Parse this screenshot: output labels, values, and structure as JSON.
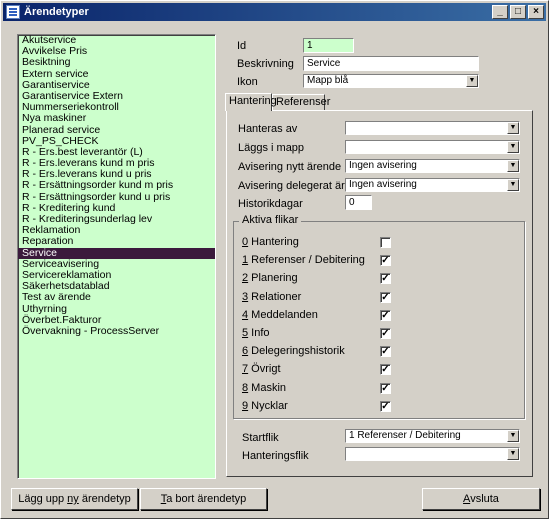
{
  "window": {
    "title": "Ärendetyper"
  },
  "list": {
    "items": [
      "Akutservice",
      "Avvikelse Pris",
      "Besiktning",
      "Extern service",
      "Garantiservice",
      "Garantiservice Extern",
      "Nummerseriekontroll",
      "Nya maskiner",
      "Planerad service",
      "PV_PS_CHECK",
      "R - Ers.best leverantör (L)",
      "R - Ers.leverans kund m pris",
      "R - Ers.leverans kund u pris",
      "R - Ersättningsorder kund m pris",
      "R - Ersättningsorder kund u pris",
      "R - Kreditering kund",
      "R - Krediteringsunderlag lev",
      "Reklamation",
      "Reparation",
      "Service",
      "Serviceavisering",
      "Servicereklamation",
      "Säkerhetsdatablad",
      "Test av ärende",
      "Uthyrning",
      "Överbet.Fakturor",
      "Övervakning - ProcessServer"
    ],
    "selected": "Service"
  },
  "form": {
    "id_label": "Id",
    "id_value": "1",
    "beskrivning_label": "Beskrivning",
    "beskrivning_value": "Service",
    "ikon_label": "Ikon",
    "ikon_value": "Mapp blå"
  },
  "tabs": [
    "Hantering",
    "Referenser"
  ],
  "hantering": {
    "hanteras_av_label": "Hanteras av",
    "hanteras_av_value": "",
    "laggs_i_mapp_label": "Läggs i mapp",
    "laggs_i_mapp_value": "",
    "avisering_nytt_label": "Avisering nytt ärende",
    "avisering_nytt_value": "Ingen avisering",
    "avisering_deleg_label": "Avisering delegerat ärende",
    "avisering_deleg_value": "Ingen avisering",
    "historikdagar_label": "Historikdagar",
    "historikdagar_value": "0"
  },
  "aktiva_flikar": {
    "title": "Aktiva flikar",
    "items": [
      {
        "key": "0",
        "rest": " Hantering",
        "checked": false
      },
      {
        "key": "1",
        "rest": " Referenser / Debitering",
        "checked": true
      },
      {
        "key": "2",
        "rest": " Planering",
        "checked": true
      },
      {
        "key": "3",
        "rest": " Relationer",
        "checked": true
      },
      {
        "key": "4",
        "rest": " Meddelanden",
        "checked": true
      },
      {
        "key": "5",
        "rest": " Info",
        "checked": true
      },
      {
        "key": "6",
        "rest": " Delegeringshistorik",
        "checked": true
      },
      {
        "key": "7",
        "rest": " Övrigt",
        "checked": true
      },
      {
        "key": "8",
        "rest": " Maskin",
        "checked": true
      },
      {
        "key": "9",
        "rest": " Nycklar",
        "checked": true
      }
    ]
  },
  "startflik": {
    "label": "Startflik",
    "value": "1 Referenser / Debitering"
  },
  "hanteringsflik": {
    "label": "Hanteringsflik",
    "value": ""
  },
  "buttons": {
    "add_pre": "Lägg upp ",
    "add_u": "ny",
    "add_post": " ärendetyp",
    "del_u": "T",
    "del_post": "a bort ärendetyp",
    "exit_u": "A",
    "exit_post": "vsluta"
  }
}
